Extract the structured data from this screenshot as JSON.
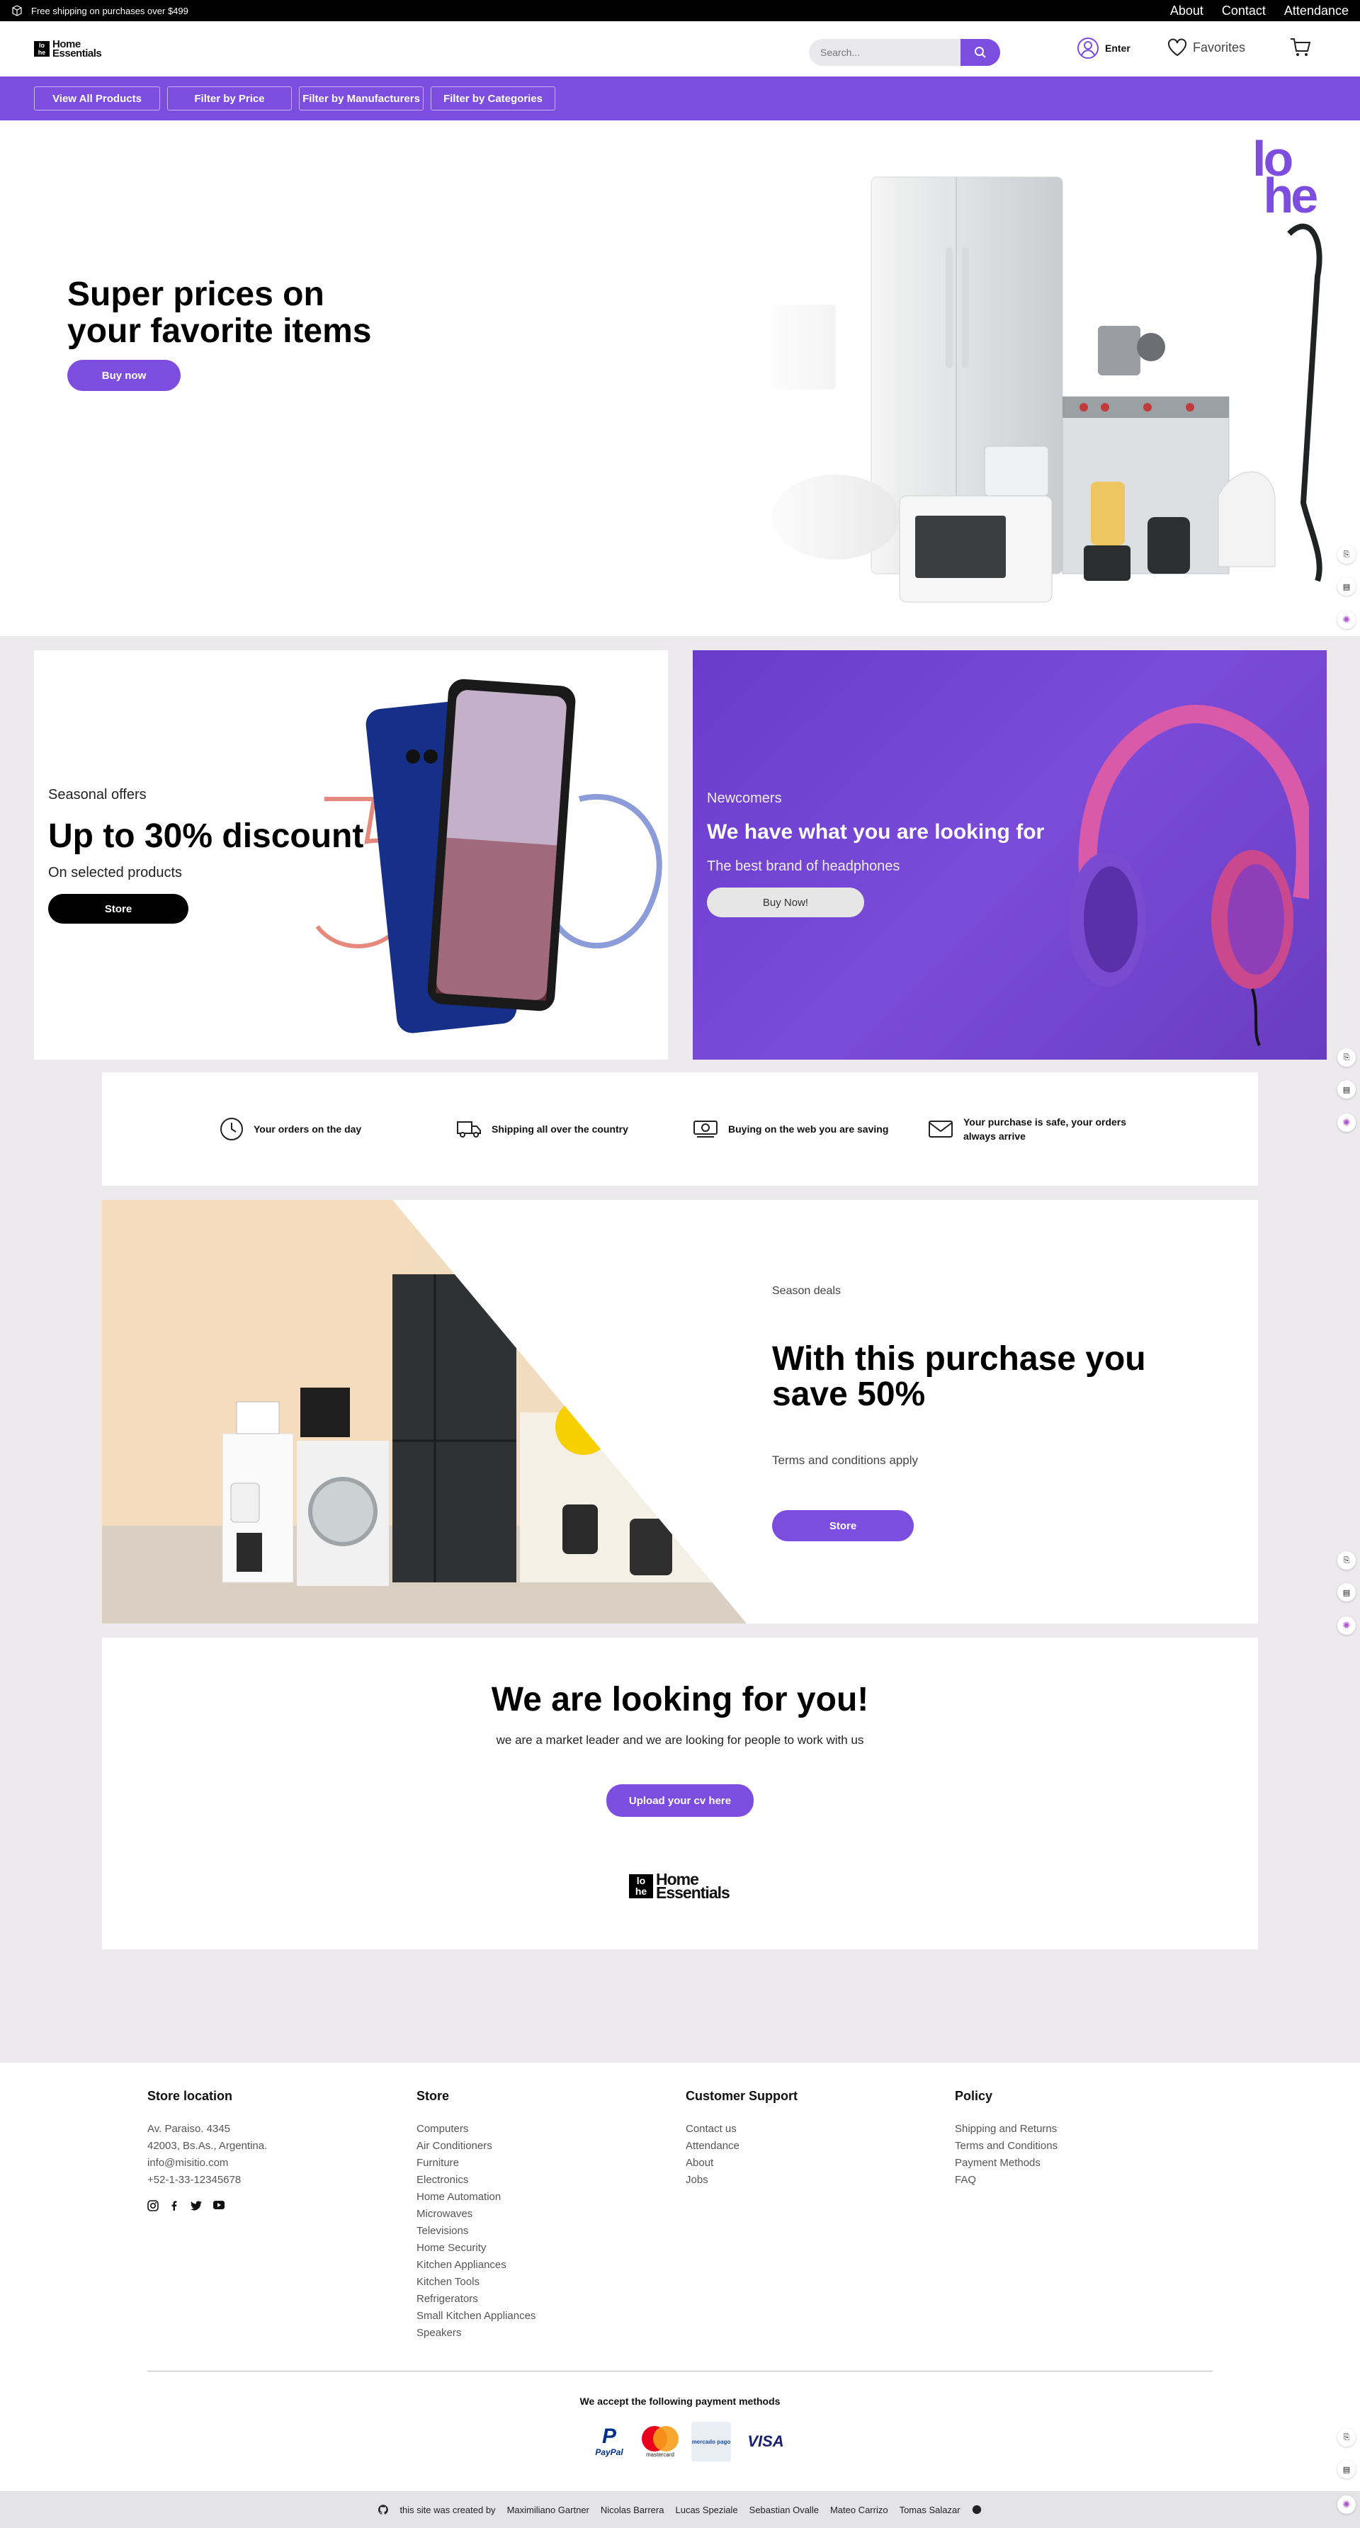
{
  "topbar": {
    "shipping_text": "Free shipping on purchases over $499",
    "links": [
      "About",
      "Contact",
      "Attendance"
    ]
  },
  "header": {
    "logo_line1": "Home",
    "logo_line2": "Essentials",
    "search_placeholder": "Search...",
    "enter_label": "Enter",
    "favorites_label": "Favorites"
  },
  "nav": {
    "filters": [
      "View All Products",
      "Filter by Price",
      "Filter by Manufacturers",
      "Filter by Categories"
    ]
  },
  "hero": {
    "title_line1": "Super prices on",
    "title_line2": "your favorite items",
    "button": "Buy now",
    "brand_mark": "ho he"
  },
  "promo_left": {
    "kicker": "Seasonal offers",
    "title": "Up to 30% discount",
    "subtitle": "On selected products",
    "button": "Store"
  },
  "promo_right": {
    "kicker": "Newcomers",
    "title": "We have what you are looking for",
    "subtitle": "The best brand of headphones",
    "button": "Buy Now!"
  },
  "features": [
    {
      "icon": "clock-icon",
      "text": "Your orders on the day"
    },
    {
      "icon": "truck-icon",
      "text": "Shipping all over the country"
    },
    {
      "icon": "money-icon",
      "text": "Buying on the web you are saving"
    },
    {
      "icon": "envelope-icon",
      "text": "Your purchase is safe, your orders always arrive"
    }
  ],
  "deal": {
    "kicker": "Season deals",
    "title_line1": "With this purchase you",
    "title_line2": "save 50%",
    "terms": "Terms and conditions apply",
    "button": "Store"
  },
  "careers": {
    "title": "We are looking for you!",
    "text": "we are a market leader and we are looking for people to work with us",
    "button": "Upload your cv here"
  },
  "footer": {
    "store_location": {
      "title": "Store location",
      "lines": [
        "Av. Paraiso. 4345",
        "42003, Bs.As., Argentina.",
        "info@misitio.com",
        "+52-1-33-12345678"
      ]
    },
    "store": {
      "title": "Store",
      "links": [
        "Computers",
        "Air Conditioners",
        "Furniture",
        "Electronics",
        "Home Automation",
        "Microwaves",
        "Televisions",
        "Home Security",
        "Kitchen Appliances",
        "Kitchen Tools",
        "Refrigerators",
        "Small Kitchen Appliances",
        "Speakers"
      ]
    },
    "support": {
      "title": "Customer Support",
      "links": [
        "Contact us",
        "Attendance",
        "About",
        "Jobs"
      ]
    },
    "policy": {
      "title": "Policy",
      "links": [
        "Shipping and Returns",
        "Terms and Conditions",
        "Payment Methods",
        "FAQ"
      ]
    },
    "payments_title": "We accept the following payment methods",
    "payments": [
      "PayPal",
      "mastercard",
      "mercado pago",
      "VISA"
    ]
  },
  "credits": {
    "prefix": "this site was created by",
    "names": [
      "Maximiliano Gartner",
      "Nicolas Barrera",
      "Lucas Speziale",
      "Sebastian Ovalle",
      "Mateo Carrizo",
      "Tomas Salazar"
    ]
  },
  "colors": {
    "accent": "#7c4ddf",
    "black": "#000000",
    "background": "#eceaec"
  }
}
